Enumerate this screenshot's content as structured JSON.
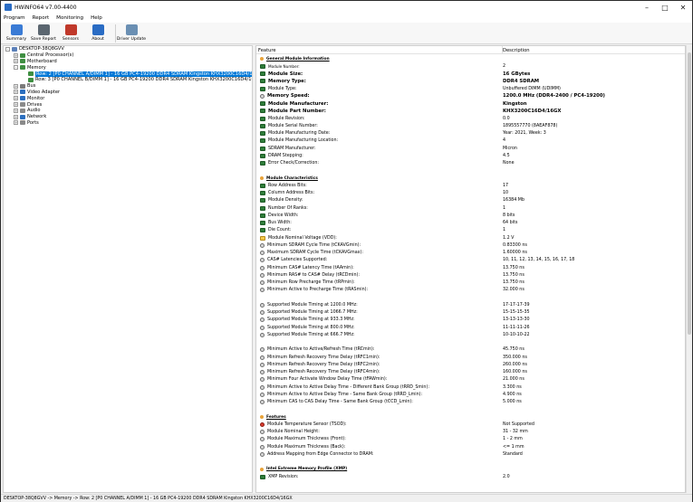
{
  "window": {
    "title": "HWiNFO64 v7.00-4400"
  },
  "menu": [
    "Program",
    "Report",
    "Monitoring",
    "Help"
  ],
  "toolbar": [
    {
      "label": "Summary",
      "icon": "monitor-icon",
      "color": "#3a7bd5"
    },
    {
      "label": "Save Report",
      "icon": "save-icon",
      "color": "#5b6670"
    },
    {
      "label": "Sensors",
      "icon": "sensors-icon",
      "color": "#c0392b"
    },
    {
      "label": "About",
      "icon": "info-icon",
      "color": "#2a6cc4"
    },
    {
      "label": "Driver Update",
      "icon": "driver-update-icon",
      "color": "#6a8fb3"
    }
  ],
  "tree": [
    {
      "label": "DESKTOP-38Q8GVV",
      "level": 0,
      "exp": "-",
      "color": "#5a7fb8"
    },
    {
      "label": "Central Processor(s)",
      "level": 1,
      "exp": "+",
      "color": "#3e8e41"
    },
    {
      "label": "Motherboard",
      "level": 1,
      "exp": "+",
      "color": "#3e8e41"
    },
    {
      "label": "Memory",
      "level": 1,
      "exp": "-",
      "color": "#3e8e41"
    },
    {
      "label": "Row: 2 [P0 CHANNEL A/DIMM 1] - 16 GB PC4-19200 DDR4 SDRAM Kingston KHX3200C16D4/16GX",
      "level": 2,
      "exp": "",
      "color": "#3e8e41",
      "selected": true
    },
    {
      "label": "Row: 3 [P0 CHANNEL B/DIMM 1] - 16 GB PC4-19200 DDR4 SDRAM Kingston KHX3200C16D4/16GX",
      "level": 2,
      "exp": "",
      "color": "#3e8e41"
    },
    {
      "label": "Bus",
      "level": 1,
      "exp": "+",
      "color": "#7b7b7b"
    },
    {
      "label": "Video Adapter",
      "level": 1,
      "exp": "+",
      "color": "#2c6fbf"
    },
    {
      "label": "Monitor",
      "level": 1,
      "exp": "+",
      "color": "#2c6fbf"
    },
    {
      "label": "Drives",
      "level": 1,
      "exp": "+",
      "color": "#8a8a8a"
    },
    {
      "label": "Audio",
      "level": 1,
      "exp": "+",
      "color": "#8a8a8a"
    },
    {
      "label": "Network",
      "level": 1,
      "exp": "+",
      "color": "#2c6fbf"
    },
    {
      "label": "Ports",
      "level": 1,
      "exp": "+",
      "color": "#8a8a8a"
    }
  ],
  "details": {
    "headers": {
      "feature": "Feature",
      "description": "Description"
    },
    "rows": [
      {
        "t": "sec",
        "f": "General Module Information",
        "icon": "dot"
      },
      {
        "f": "Module Number:",
        "v": "2",
        "icon": "chip",
        "small": true
      },
      {
        "t": "b",
        "f": "Module Size:",
        "v": "16 GBytes",
        "icon": "chip"
      },
      {
        "t": "b",
        "f": "Memory Type:",
        "v": "DDR4 SDRAM",
        "icon": "chip"
      },
      {
        "f": "Module Type:",
        "v": "Unbuffered DIMM (UDIMM)",
        "icon": "chip"
      },
      {
        "t": "b",
        "f": "Memory Speed:",
        "v": "1200.0 MHz (DDR4-2400 / PC4-19200)",
        "icon": "clock"
      },
      {
        "t": "b",
        "f": "Module Manufacturer:",
        "v": "Kingston",
        "icon": "chip"
      },
      {
        "t": "b",
        "f": "Module Part Number:",
        "v": "KHX3200C16D4/16GX",
        "icon": "chip"
      },
      {
        "f": "Module Revision:",
        "v": "0.0",
        "icon": "chip"
      },
      {
        "f": "Module Serial Number:",
        "v": "1895557770 (8AEAF878)",
        "icon": "chip"
      },
      {
        "f": "Module Manufacturing Date:",
        "v": "Year: 2021, Week: 3",
        "icon": "chip"
      },
      {
        "f": "Module Manufacturing Location:",
        "v": "4",
        "icon": "chip"
      },
      {
        "f": "SDRAM Manufacturer:",
        "v": "Micron",
        "icon": "chip"
      },
      {
        "f": "DRAM Stepping:",
        "v": "4.5",
        "icon": "chip"
      },
      {
        "f": "Error Check/Correction:",
        "v": "None",
        "icon": "chip"
      },
      {
        "t": "gap"
      },
      {
        "t": "sec",
        "f": "Module Characteristics",
        "icon": "dot"
      },
      {
        "f": "Row Address Bits:",
        "v": "17",
        "icon": "chip"
      },
      {
        "f": "Column Address Bits:",
        "v": "10",
        "icon": "chip"
      },
      {
        "f": "Module Density:",
        "v": "16384 Mb",
        "icon": "chip"
      },
      {
        "f": "Number Of Ranks:",
        "v": "1",
        "icon": "chip"
      },
      {
        "f": "Device Width:",
        "v": "8 bits",
        "icon": "chip"
      },
      {
        "f": "Bus Width:",
        "v": "64 bits",
        "icon": "chip"
      },
      {
        "f": "Die Count:",
        "v": "1",
        "icon": "chip"
      },
      {
        "f": "Module Nominal Voltage (VDD):",
        "v": "1.2 V",
        "icon": "volt"
      },
      {
        "f": "Minimum SDRAM Cycle Time (tCKAVGmin):",
        "v": "0.83300 ns",
        "icon": "clock"
      },
      {
        "f": "Maximum SDRAM Cycle Time (tCKAVGmax):",
        "v": "1.60000 ns",
        "icon": "clock"
      },
      {
        "f": "CAS# Latencies Supported:",
        "v": "10, 11, 12, 13, 14, 15, 16, 17, 18",
        "icon": "clock"
      },
      {
        "f": "Minimum CAS# Latency Time (tAAmin):",
        "v": "13.750 ns",
        "icon": "clock"
      },
      {
        "f": "Minimum RAS# to CAS# Delay (tRCDmin):",
        "v": "13.750 ns",
        "icon": "clock"
      },
      {
        "f": "Minimum Row Precharge Time (tRPmin):",
        "v": "13.750 ns",
        "icon": "clock"
      },
      {
        "f": "Minimum Active to Precharge Time (tRASmin):",
        "v": "32.000 ns",
        "icon": "clock"
      },
      {
        "t": "gap"
      },
      {
        "f": "Supported Module Timing at 1200.0 MHz:",
        "v": "17-17-17-39",
        "icon": "clock"
      },
      {
        "f": "Supported Module Timing at 1066.7 MHz:",
        "v": "15-15-15-35",
        "icon": "clock"
      },
      {
        "f": "Supported Module Timing at 933.3 MHz:",
        "v": "13-13-13-30",
        "icon": "clock"
      },
      {
        "f": "Supported Module Timing at 800.0 MHz:",
        "v": "11-11-11-26",
        "icon": "clock"
      },
      {
        "f": "Supported Module Timing at 666.7 MHz:",
        "v": "10-10-10-22",
        "icon": "clock"
      },
      {
        "t": "gap"
      },
      {
        "f": "Minimum Active to Active/Refresh Time (tRCmin):",
        "v": "45.750 ns",
        "icon": "clock"
      },
      {
        "f": "Minimum Refresh Recovery Time Delay (tRFC1min):",
        "v": "350.000 ns",
        "icon": "clock"
      },
      {
        "f": "Minimum Refresh Recovery Time Delay (tRFC2min):",
        "v": "260.000 ns",
        "icon": "clock"
      },
      {
        "f": "Minimum Refresh Recovery Time Delay (tRFC4min):",
        "v": "160.000 ns",
        "icon": "clock"
      },
      {
        "f": "Minimum Four Activate Window Delay Time (tFAWmin):",
        "v": "21.000 ns",
        "icon": "clock"
      },
      {
        "f": "Minimum Active to Active Delay Time - Different Bank Group (tRRD_Smin):",
        "v": "3.300 ns",
        "icon": "clock"
      },
      {
        "f": "Minimum Active to Active Delay Time - Same Bank Group (tRRD_Lmin):",
        "v": "4.900 ns",
        "icon": "clock"
      },
      {
        "f": "Minimum CAS to CAS Delay Time - Same Bank Group (tCCD_Lmin):",
        "v": "5.000 ns",
        "icon": "clock"
      },
      {
        "t": "gap"
      },
      {
        "t": "sec",
        "f": "Features",
        "icon": "dot"
      },
      {
        "f": "Module Temperature Sensor (TSOD):",
        "v": "Not Supported",
        "icon": "warn"
      },
      {
        "f": "Module Nominal Height:",
        "v": "31 - 32 mm",
        "icon": "clock"
      },
      {
        "f": "Module Maximum Thickness (Front):",
        "v": "1 - 2 mm",
        "icon": "clock"
      },
      {
        "f": "Module Maximum Thickness (Back):",
        "v": "<= 1 mm",
        "icon": "clock"
      },
      {
        "f": "Address Mapping from Edge Connector to DRAM:",
        "v": "Standard",
        "icon": "clock"
      },
      {
        "t": "gap"
      },
      {
        "t": "sec",
        "f": "Intel Extreme Memory Profile (XMP)",
        "icon": "dot"
      },
      {
        "f": "XMP Revision:",
        "v": "2.0",
        "icon": "chip"
      }
    ]
  },
  "status": "DESKTOP-38Q8GVV -> Memory -> Row: 2 [P0 CHANNEL A/DIMM 1] - 16 GB PC4-19200 DDR4 SDRAM Kingston KHX3200C16D4/16GX"
}
